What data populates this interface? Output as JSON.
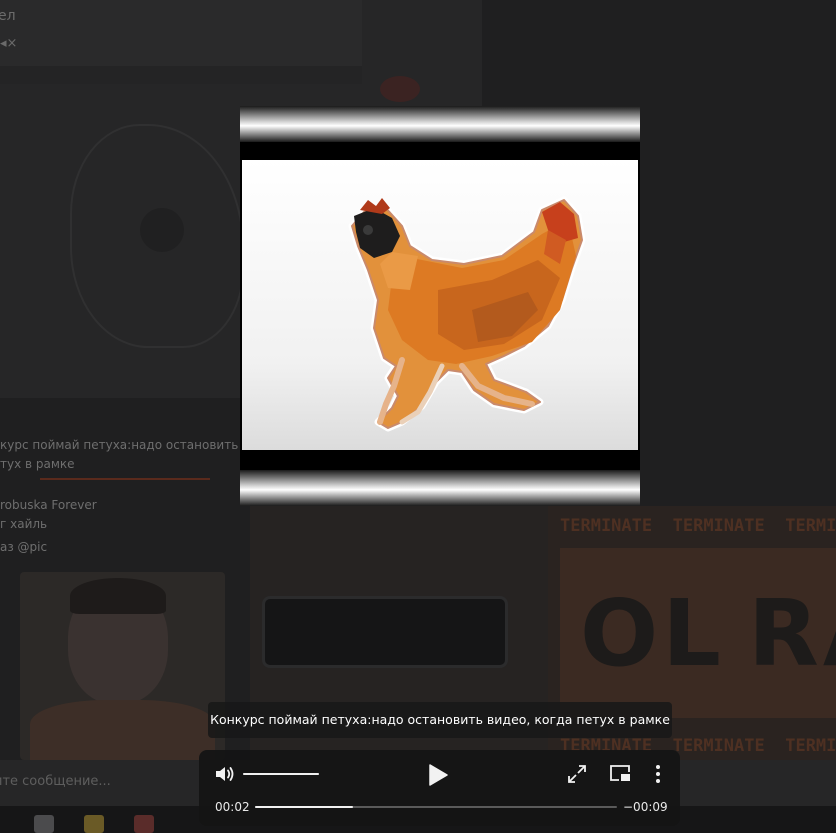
{
  "background": {
    "chat_title_fragment": "ел",
    "message_lines": [
      "курс поймай петуха:надо остановить в",
      "тух в рамке"
    ],
    "sender_name": "robuska Forever",
    "message_text": "г хайль",
    "meta_text": "аз @pic",
    "input_placeholder": "ите сообщение...",
    "poster_word": "TERMINATE",
    "poster_big_left": "OL",
    "poster_big_right": "RA"
  },
  "video": {
    "subject": "dancing rooster"
  },
  "caption": {
    "text": "Конкурс поймай петуха:надо остановить видео, когда петух в рамке"
  },
  "player": {
    "current_time": "00:02",
    "remaining_time": "−00:09",
    "progress_fraction": 0.27,
    "volume_fraction": 1.0,
    "icons": {
      "volume": "volume-icon",
      "play": "play-icon",
      "fullscreen": "fullscreen-icon",
      "pip": "picture-in-picture-icon",
      "more": "more-vertical-icon"
    }
  }
}
